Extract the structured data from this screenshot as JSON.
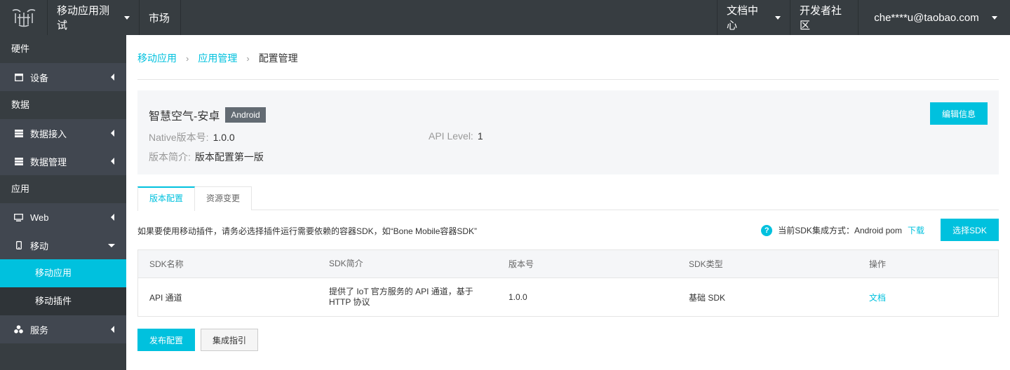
{
  "colors": {
    "topbar": "#373d41",
    "sidebar": "#373d41",
    "accent": "#00c1de",
    "tag": "#636b73"
  },
  "topbar": {
    "app_menu": "移动应用测试",
    "market": "市场",
    "docs": "文档中心",
    "community": "开发者社区",
    "user": "che****u@taobao.com"
  },
  "sidebar": {
    "groups": [
      "硬件",
      "数据",
      "应用"
    ],
    "items": {
      "device": {
        "label": "设备",
        "icon": "device-icon"
      },
      "data_access": {
        "label": "数据接入",
        "icon": "database-icon"
      },
      "data_manage": {
        "label": "数据管理",
        "icon": "database-icon"
      },
      "web": {
        "label": "Web",
        "icon": "monitor-icon"
      },
      "mobile": {
        "label": "移动",
        "icon": "phone-icon"
      },
      "service": {
        "label": "服务",
        "icon": "cubes-icon"
      }
    },
    "mobile_sub": [
      "移动应用",
      "移动插件"
    ]
  },
  "breadcrumb": [
    "移动应用",
    "应用管理",
    "配置管理"
  ],
  "app_info": {
    "name": "智慧空气-安卓",
    "platform": "Android",
    "native_version_label": "Native版本号:",
    "native_version": "1.0.0",
    "api_level_label": "API Level:",
    "api_level": "1",
    "desc_label": "版本简介:",
    "desc": "版本配置第一版",
    "edit_button": "编辑信息"
  },
  "tabs": [
    "版本配置",
    "资源变更"
  ],
  "notice": "如果要使用移动插件，请务必选择插件运行需要依赖的容器SDK，如“Bone Mobile容器SDK”",
  "sdk_mode": {
    "help": "?",
    "text": "当前SDK集成方式：Android pom",
    "download": "下载",
    "choose_button": "选择SDK"
  },
  "table": {
    "headers": [
      "SDK名称",
      "SDK简介",
      "版本号",
      "SDK类型",
      "操作"
    ],
    "rows": [
      {
        "name": "API 通道",
        "desc": "提供了 IoT 官方服务的 API 通道，基于 HTTP 协议",
        "version": "1.0.0",
        "type": "基础 SDK",
        "action": "文档"
      }
    ]
  },
  "buttons": {
    "publish": "发布配置",
    "guide": "集成指引"
  }
}
